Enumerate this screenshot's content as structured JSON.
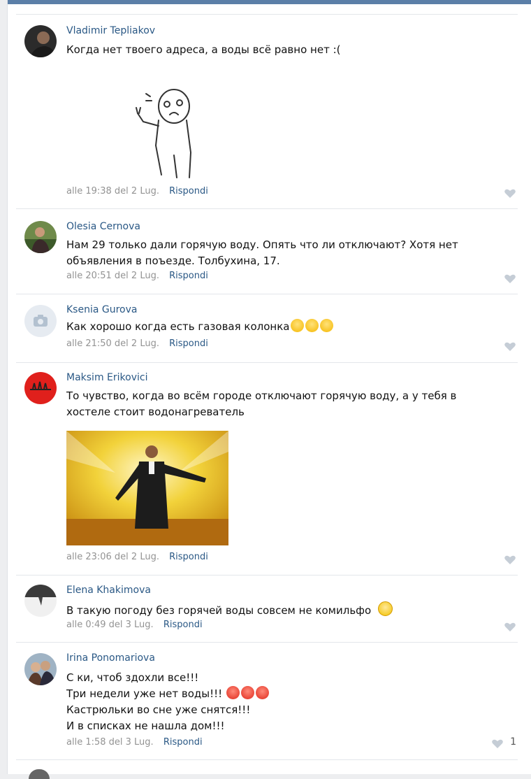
{
  "comments": [
    {
      "author": "Vladimir Tepliakov",
      "lines": [
        "Когда нет твоего адреса, а воды всё равно нет :("
      ],
      "time": "alle 19:38 del 2 Lug.",
      "reply": "Rispondi",
      "avatar_icon": "user-photo-icon",
      "attachment_icon": "meme-sticker-icon"
    },
    {
      "author": "Olesia Cernova",
      "lines": [
        "Нам 29 только дали горячую воду. Опять что ли отключают? Хотя нет",
        "объявления в поъезде. Толбухина, 17."
      ],
      "time": "alle 20:51 del 2 Lug.",
      "reply": "Rispondi",
      "avatar_icon": "user-photo-icon"
    },
    {
      "author": "Ksenia Gurova",
      "lines": [
        "Как хорошо когда есть газовая колонка"
      ],
      "time": "alle 21:50 del 2 Lug.",
      "reply": "Rispondi",
      "avatar_icon": "camera-placeholder-icon",
      "emoji": [
        "laughing-emoji-icon",
        "laughing-emoji-icon",
        "laughing-emoji-icon"
      ]
    },
    {
      "author": "Maksim Erikovici",
      "lines": [
        "То чувство, когда во всём городе отключают горячую воду, а у тебя в",
        "хостеле стоит водонагреватель"
      ],
      "time": "alle 23:06 del 2 Lug.",
      "reply": "Rispondi",
      "avatar_icon": "red-logo-icon",
      "attachment_icon": "celebration-photo-icon"
    },
    {
      "author": "Elena Khakimova",
      "lines": [
        "В такую погоду без горячей воды совсем не комильфо"
      ],
      "time": "alle 0:49 del 3 Lug.",
      "reply": "Rispondi",
      "avatar_icon": "user-photo-icon",
      "emoji": [
        "worried-emoji-icon"
      ]
    },
    {
      "author": "Irina Ponomariova",
      "lines": [
        "С    ки, чтоб здохли все!!!",
        "Три недели уже нет воды!!!",
        "Кастрюльки во сне уже снятся!!!",
        "И в списках не нашла дом!!!"
      ],
      "time": "alle 1:58 del 3 Lug.",
      "reply": "Rispondi",
      "avatar_icon": "user-photo-icon",
      "emoji": [
        "angry-emoji-icon",
        "angry-emoji-icon",
        "angry-emoji-icon"
      ],
      "likes": "1"
    }
  ],
  "icons": {
    "like": "heart-icon"
  },
  "colors": {
    "link": "#2a5885",
    "meta": "#939393",
    "heart": "#c5cdd6",
    "topbar": "#5b7fa8"
  }
}
